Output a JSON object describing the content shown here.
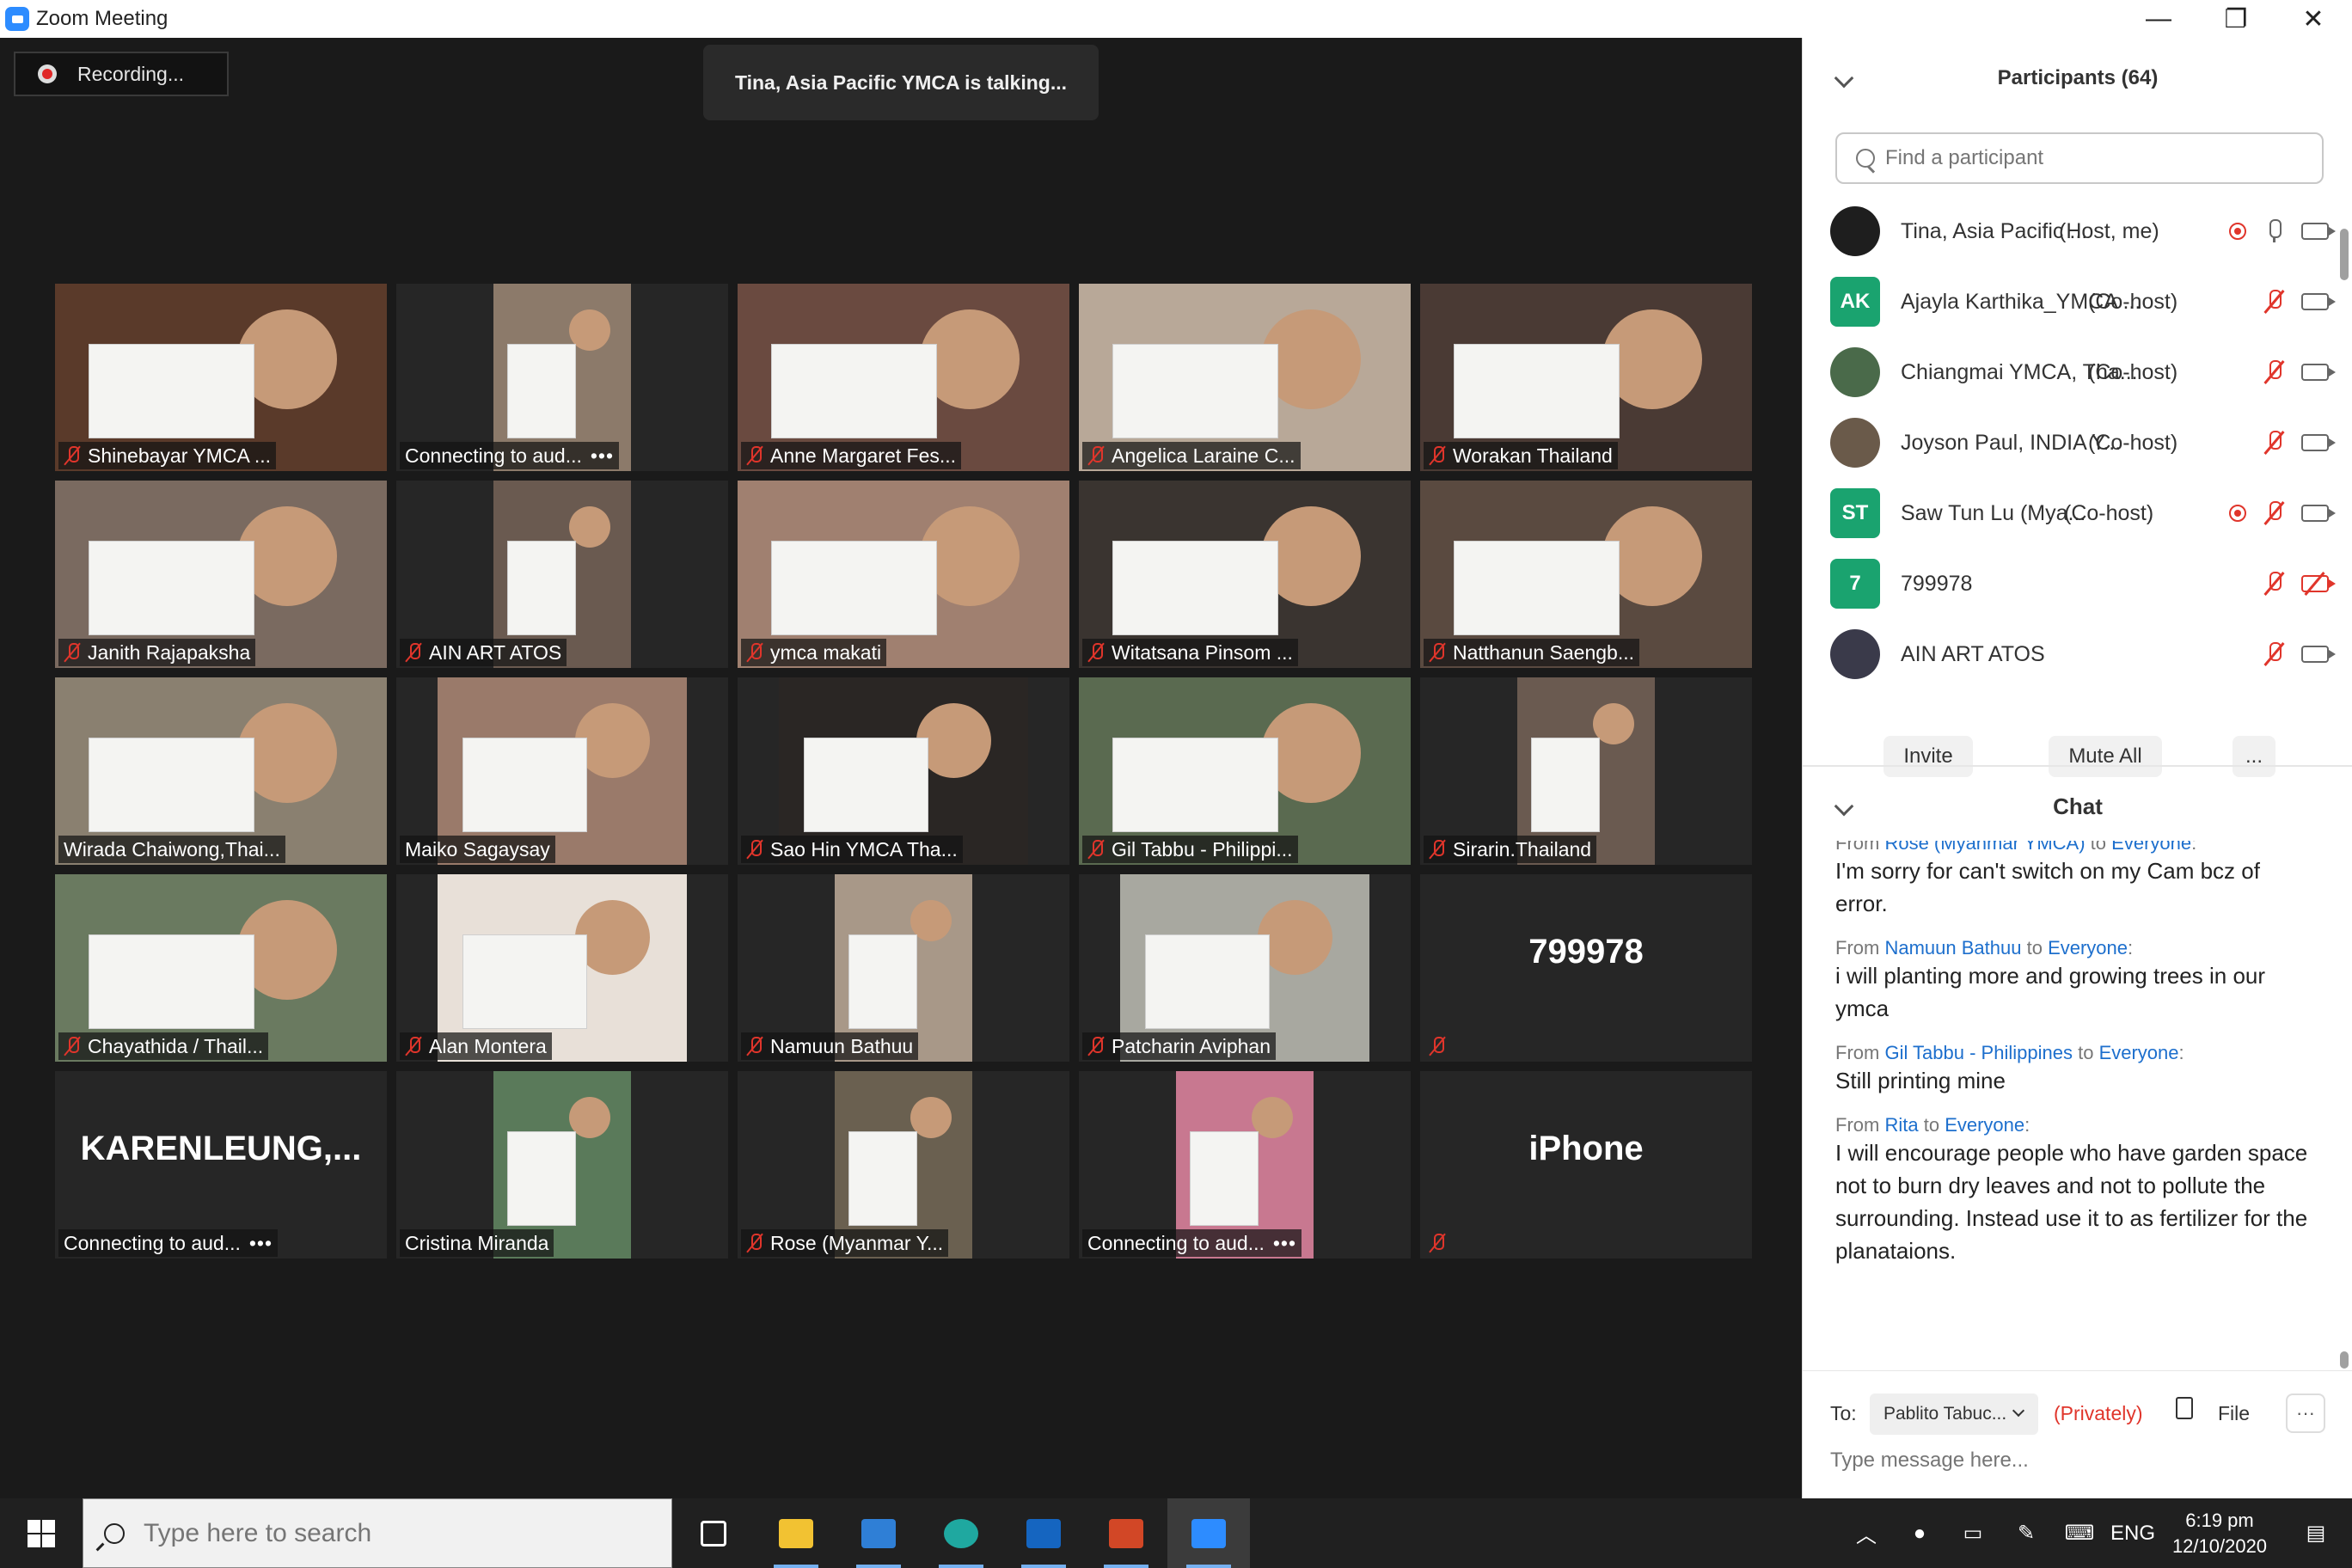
{
  "window": {
    "title": "Zoom Meeting",
    "minimize": "—",
    "restore": "❐",
    "close": "✕"
  },
  "meeting": {
    "recording_label": "Recording...",
    "talking_banner": "Tina, Asia Pacific YMCA is talking..."
  },
  "tiles": [
    {
      "label": "Shinebayar YMCA ...",
      "muted": true,
      "kind": "video",
      "bg": "#5a3a2a"
    },
    {
      "label": "Connecting to aud...",
      "muted": false,
      "kind": "video",
      "bg": "#8c7a6a",
      "dots": "•••"
    },
    {
      "label": "Anne Margaret Fes...",
      "muted": true,
      "kind": "video",
      "bg": "#6a4a40"
    },
    {
      "label": "Angelica Laraine C...",
      "muted": true,
      "kind": "video",
      "bg": "#b8a898"
    },
    {
      "label": "Worakan Thailand",
      "muted": true,
      "kind": "video",
      "bg": "#4a3a34"
    },
    {
      "label": "Janith Rajapaksha",
      "muted": true,
      "kind": "video",
      "bg": "#7a6a60"
    },
    {
      "label": "AIN ART ATOS",
      "muted": true,
      "kind": "video",
      "bg": "#6a5a50"
    },
    {
      "label": "ymca makati",
      "muted": true,
      "kind": "video",
      "bg": "#a08070"
    },
    {
      "label": "Witatsana Pinsom ...",
      "muted": true,
      "kind": "video",
      "bg": "#3a3430"
    },
    {
      "label": "Natthanun Saengb...",
      "muted": true,
      "kind": "video",
      "bg": "#5a4a40"
    },
    {
      "label": "Wirada Chaiwong,Thai...",
      "muted": false,
      "kind": "video",
      "bg": "#8a8070"
    },
    {
      "label": "Maiko Sagaysay",
      "muted": false,
      "kind": "video",
      "bg": "#9a7a6a"
    },
    {
      "label": "Sao Hin YMCA Tha...",
      "muted": true,
      "kind": "video",
      "bg": "#2a2624"
    },
    {
      "label": "Gil Tabbu - Philippi...",
      "muted": true,
      "kind": "video",
      "bg": "#5a6a50"
    },
    {
      "label": "Sirarin.Thailand",
      "muted": true,
      "kind": "video",
      "bg": "#6a5a50"
    },
    {
      "label": "Chayathida / Thail...",
      "muted": true,
      "kind": "video",
      "bg": "#6a7a60"
    },
    {
      "label": "Alan Montera",
      "muted": true,
      "kind": "video",
      "bg": "#e8e0d8"
    },
    {
      "label": "Namuun Bathuu",
      "muted": true,
      "kind": "video",
      "bg": "#a89888"
    },
    {
      "label": "Patcharin Aviphan",
      "muted": true,
      "kind": "video",
      "bg": "#a8a8a0"
    },
    {
      "label": "",
      "muted": true,
      "kind": "name",
      "bigname": "799978"
    },
    {
      "label": "Connecting to aud...",
      "muted": false,
      "kind": "name",
      "bigname": "KARENLEUNG,...",
      "dots": "•••"
    },
    {
      "label": "Cristina Miranda",
      "muted": false,
      "kind": "video",
      "bg": "#5a7a5a"
    },
    {
      "label": "Rose (Myanmar Y...",
      "muted": true,
      "kind": "video",
      "bg": "#6a6050"
    },
    {
      "label": "Connecting to aud...",
      "muted": false,
      "kind": "video",
      "bg": "#c87890",
      "dots": "•••"
    },
    {
      "label": "",
      "muted": true,
      "kind": "name",
      "bigname": "iPhone"
    }
  ],
  "participants": {
    "header": "Participants (64)",
    "search_placeholder": "Find a participant",
    "list": [
      {
        "name": "Tina, Asia Pacific ...",
        "role": "(Host, me)",
        "avatar": "",
        "avatar_color": "#1e1e1e",
        "recording": true,
        "mic_muted": false,
        "cam_off": false
      },
      {
        "name": "Ajayla Karthika_YMCA ...",
        "role": "(Co-host)",
        "avatar": "AK",
        "avatar_color": "#1aa36f",
        "recording": false,
        "mic_muted": true,
        "cam_off": false
      },
      {
        "name": "Chiangmai YMCA, Tha...",
        "role": "(Co-host)",
        "avatar": "",
        "avatar_color": "#4a6a4a",
        "recording": false,
        "mic_muted": true,
        "cam_off": false
      },
      {
        "name": "Joyson Paul, INDIA Y...",
        "role": "(Co-host)",
        "avatar": "",
        "avatar_color": "#6a5a4a",
        "recording": false,
        "mic_muted": true,
        "cam_off": false
      },
      {
        "name": "Saw Tun Lu (Mya...",
        "role": "(Co-host)",
        "avatar": "ST",
        "avatar_color": "#1aa36f",
        "recording": true,
        "mic_muted": true,
        "cam_off": false
      },
      {
        "name": "799978",
        "role": "",
        "avatar": "7",
        "avatar_color": "#1aa36f",
        "recording": false,
        "mic_muted": true,
        "cam_off": true
      },
      {
        "name": "AIN ART ATOS",
        "role": "",
        "avatar": "",
        "avatar_color": "#3a3a4a",
        "recording": false,
        "mic_muted": true,
        "cam_off": false
      }
    ],
    "invite": "Invite",
    "mute_all": "Mute All",
    "more": "..."
  },
  "chat": {
    "header": "Chat",
    "messages": [
      {
        "from_prefix": "From",
        "sender": "Rose (Myanmar YMCA)",
        "to_word": "to",
        "recipient": "Everyone",
        "text": "I'm sorry for can't switch on my Cam bcz of error.",
        "cut": true
      },
      {
        "from_prefix": "From",
        "sender": "Namuun Bathuu",
        "to_word": "to",
        "recipient": "Everyone",
        "text": "i will planting more and growing trees in our ymca"
      },
      {
        "from_prefix": "From",
        "sender": "Gil Tabbu - Philippines",
        "to_word": "to",
        "recipient": "Everyone",
        "text": "Still printing mine"
      },
      {
        "from_prefix": "From",
        "sender": "Rita",
        "to_word": "to",
        "recipient": "Everyone",
        "text": "I will encourage people who have garden space not to burn dry leaves and not to pollute the surrounding. Instead use it to as fertilizer for the planataions."
      }
    ],
    "to_label": "To:",
    "to_value": "Pablito Tabuc...",
    "privately": "(Privately)",
    "file_label": "File",
    "more": "···",
    "input_placeholder": "Type message here..."
  },
  "taskbar": {
    "search_placeholder": "Type here to search",
    "language": "ENG",
    "time": "6:19 pm",
    "date": "12/10/2020",
    "apps": [
      {
        "name": "task-view",
        "color": "#ffffff"
      },
      {
        "name": "file-explorer",
        "color": "#f2c232"
      },
      {
        "name": "mail",
        "color": "#2f7fd6"
      },
      {
        "name": "edge",
        "color": "#1fa8a0"
      },
      {
        "name": "outlook",
        "color": "#1565c0"
      },
      {
        "name": "powerpoint",
        "color": "#d24726"
      },
      {
        "name": "zoom",
        "color": "#2d8cff"
      }
    ]
  }
}
